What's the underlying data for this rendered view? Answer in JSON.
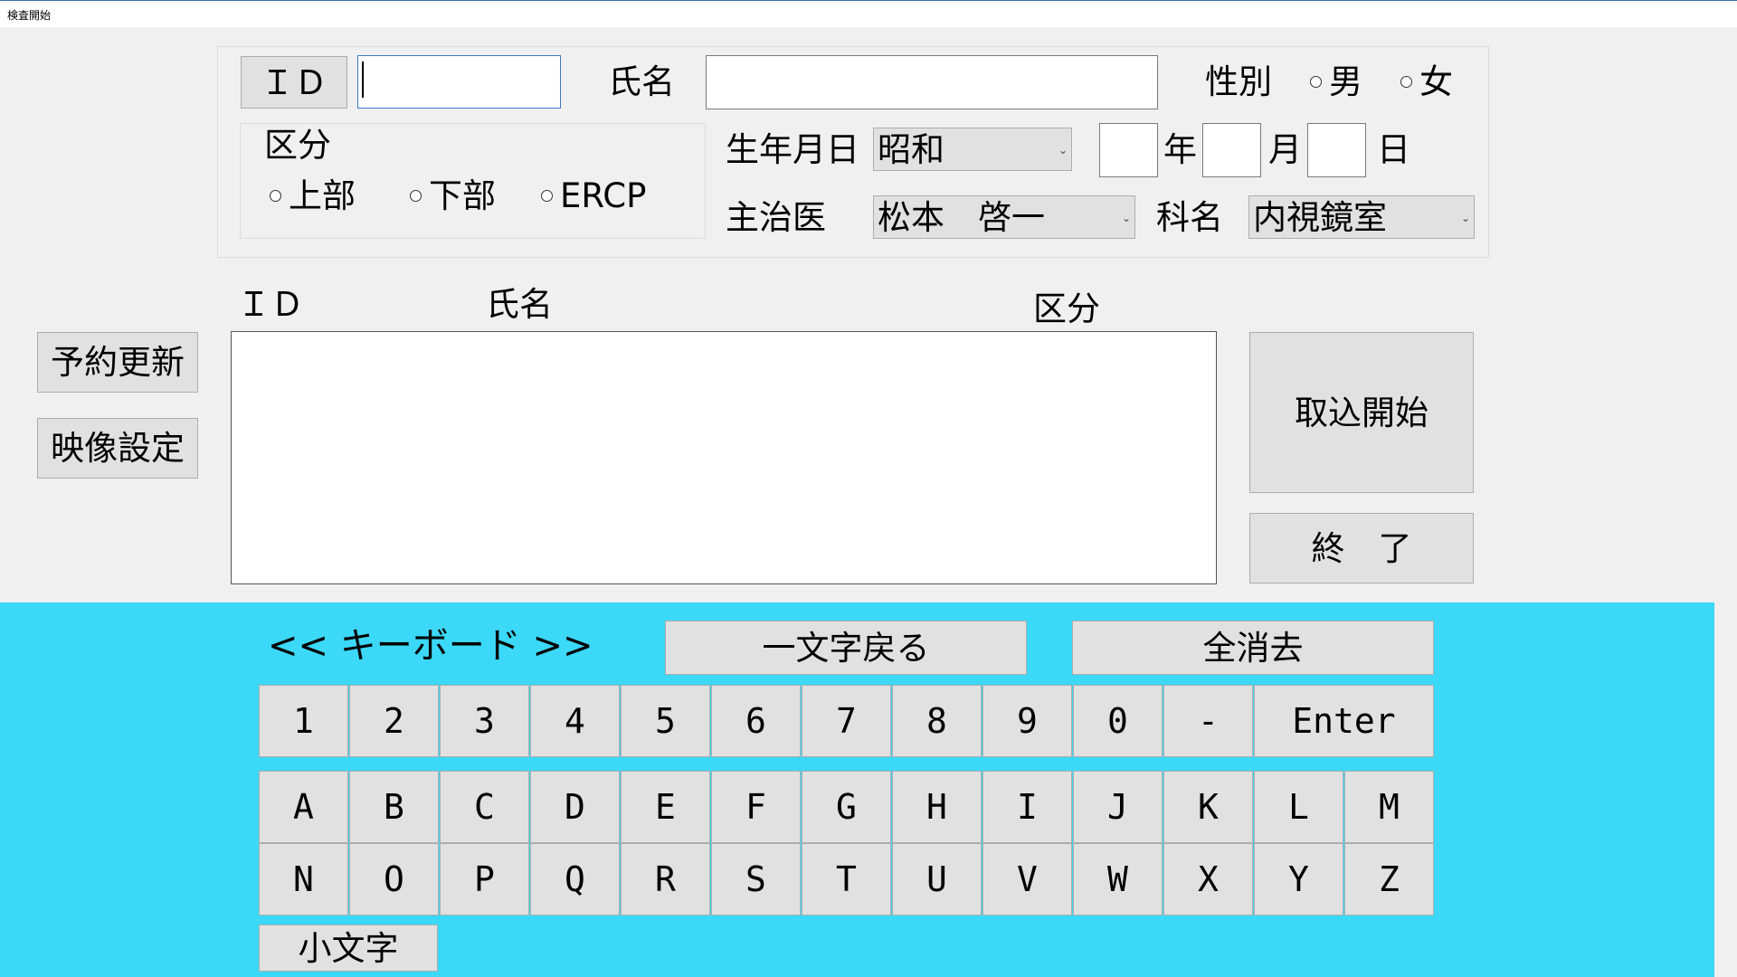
{
  "window": {
    "title": "検査開始"
  },
  "form": {
    "id_button": "ＩＤ",
    "id_value": "",
    "name_label": "氏名",
    "name_value": "",
    "sex_label": "性別",
    "sex_options": [
      "男",
      "女"
    ],
    "category": {
      "label": "区分",
      "options": [
        "上部",
        "下部",
        "ERCP"
      ]
    },
    "birth_label": "生年月日",
    "era_value": "昭和",
    "year_value": "",
    "year_unit": "年",
    "month_value": "",
    "month_unit": "月",
    "day_value": "",
    "day_unit": "日",
    "doctor_label": "主治医",
    "doctor_value": "松本　啓一",
    "dept_label": "科名",
    "dept_value": "内視鏡室"
  },
  "list": {
    "headers": [
      "ＩＤ",
      "氏名",
      "区分"
    ],
    "rows": []
  },
  "side_buttons": {
    "reservation_update": "予約更新",
    "video_settings": "映像設定",
    "start_capture": "取込開始",
    "exit": "終　了"
  },
  "keyboard": {
    "title": "<< キーボード >>",
    "backspace": "一文字戻る",
    "clear_all": "全消去",
    "row1": [
      "1",
      "2",
      "3",
      "4",
      "5",
      "6",
      "7",
      "8",
      "9",
      "0",
      "-"
    ],
    "enter": "Enter",
    "row2": [
      "A",
      "B",
      "C",
      "D",
      "E",
      "F",
      "G",
      "H",
      "I",
      "J",
      "K",
      "L",
      "M"
    ],
    "row3": [
      "N",
      "O",
      "P",
      "Q",
      "R",
      "S",
      "T",
      "U",
      "V",
      "W",
      "X",
      "Y",
      "Z"
    ],
    "lowercase": "小文字"
  },
  "colors": {
    "keyboard_bg": "#3cd8f8",
    "window_bg": "#f0f0f0"
  }
}
